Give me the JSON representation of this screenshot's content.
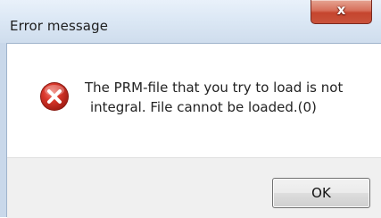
{
  "window": {
    "title": "Error message",
    "close_glyph": "x"
  },
  "content": {
    "icon": "error-icon",
    "message_lines": [
      "The PRM-file that you try to load is not",
      "integral. File cannot be loaded.(0)"
    ]
  },
  "buttons": {
    "ok_label": "OK"
  },
  "colors": {
    "icon_red": "#c62828",
    "close_button_red": "#c5452e",
    "title_bar": "#dce8f5",
    "button_strip": "#f0f0f0"
  }
}
